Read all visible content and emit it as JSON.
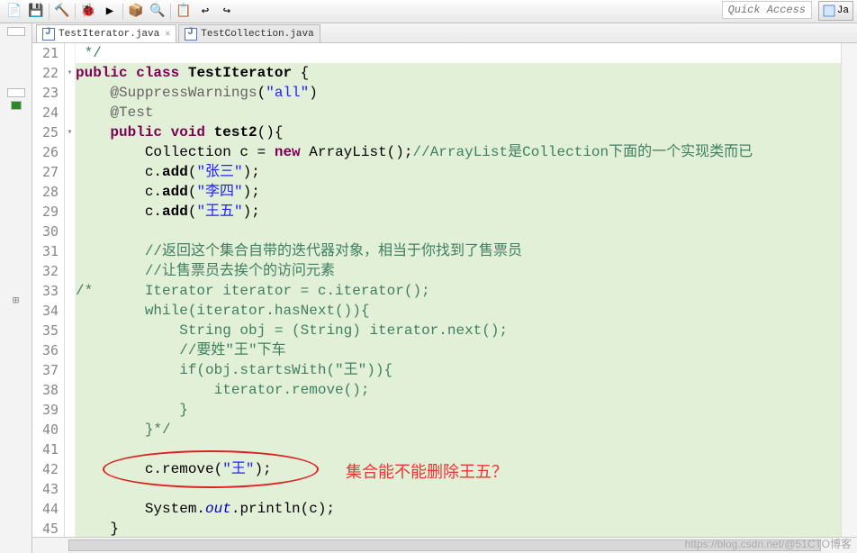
{
  "toolbar": {
    "quick_access": "Quick Access",
    "perspective": "Ja"
  },
  "tabs": [
    {
      "label": "TestIterator.java",
      "active": true
    },
    {
      "label": "TestCollection.java",
      "active": false
    }
  ],
  "line_numbers": [
    21,
    22,
    23,
    24,
    25,
    26,
    27,
    28,
    29,
    30,
    31,
    32,
    33,
    34,
    35,
    36,
    37,
    38,
    39,
    40,
    41,
    42,
    43,
    44,
    45
  ],
  "code": {
    "l21": " */",
    "l22_kw1": "public",
    "l22_kw2": "class",
    "l22_cls": "TestIterator",
    "l22_brace": " {",
    "l23_ann": "@SuppressWarnings",
    "l23_paren": "(",
    "l23_str": "\"all\"",
    "l23_close": ")",
    "l24_ann": "@Test",
    "l25_kw1": "public",
    "l25_kw2": "void",
    "l25_fn": "test2",
    "l25_rest": "(){",
    "l26_a": "        Collection c = ",
    "l26_kw": "new",
    "l26_b": " ArrayList();",
    "l26_cm": "//ArrayList是Collection下面的一个实现类而已",
    "l27_a": "        c.",
    "l27_m": "add",
    "l27_b": "(",
    "l27_s": "\"张三\"",
    "l27_c": ");",
    "l28_a": "        c.",
    "l28_m": "add",
    "l28_b": "(",
    "l28_s": "\"李四\"",
    "l28_c": ");",
    "l29_a": "        c.",
    "l29_m": "add",
    "l29_b": "(",
    "l29_s": "\"王五\"",
    "l29_c": ");",
    "l30": "",
    "l31_cm": "        //返回这个集合自带的迭代器对象，相当于你找到了售票员",
    "l32_cm": "        //让售票员去挨个的访问元素",
    "l33_cm": "/*      Iterator iterator = c.iterator();",
    "l34_cm": "        while(iterator.hasNext()){",
    "l35_cm": "            String obj = (String) iterator.next();",
    "l36_cm": "            //要姓\"王\"下车",
    "l37_cm": "            if(obj.startsWith(\"王\")){",
    "l38_cm": "                iterator.remove();",
    "l39_cm": "            }",
    "l40_cm": "        }*/",
    "l41": "",
    "l42_a": "        c.remove(",
    "l42_s": "\"王\"",
    "l42_b": ");",
    "l43": "",
    "l44_a": "        System.",
    "l44_fld": "out",
    "l44_b": ".println(c);",
    "l45": "    }"
  },
  "annotation_text": "集合能不能删除王五？",
  "watermark": "https://blog.csdn.net/@51CTO博客"
}
